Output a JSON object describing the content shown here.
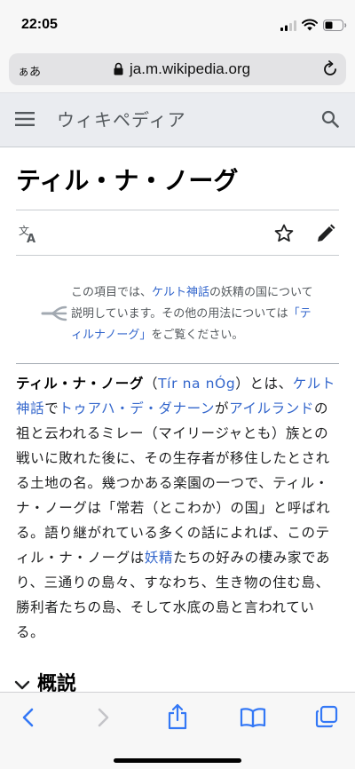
{
  "status": {
    "time": "22:05"
  },
  "address_bar": {
    "text_size_label": "ぁあ",
    "url": "ja.m.wikipedia.org"
  },
  "header": {
    "logo": "ウィキペディア"
  },
  "page": {
    "title": "ティル・ナ・ノーグ"
  },
  "hatnote": {
    "t1": "この項目では、",
    "link1": "ケルト神話",
    "t2": "の妖精の国について説明しています。その他の用法については",
    "link2": "「ティルナノーグ」",
    "t3": "をご覧ください。"
  },
  "article": {
    "bold": "ティル・ナ・ノーグ",
    "p1": "（",
    "link_irish": "Tír na nÓg",
    "p2": "）とは、",
    "link_celtic": "ケルト神話",
    "p3": "で",
    "link_tuatha": "トゥアハ・デ・ダナーン",
    "p4": "が",
    "link_ireland": "アイルランド",
    "p5": "の祖と云われるミレー（マイリージャとも）族との戦いに敗れた後に、その生存者が移住したとされる土地の名。幾つかある楽園の一つで、ティル・ナ・ノーグは「常若（とこわか）の国」と呼ばれる。語り継がれている多くの話によれば、このティル・ナ・ノーグは",
    "link_fairy": "妖精",
    "p6": "たちの好みの棲み家であり、三通りの島々、すなわち、生き物の住む島、勝利者たちの島、そして水底の島と言われている。"
  },
  "section": {
    "heading": "概説"
  },
  "icons": {
    "menu": "hamburger-menu-icon",
    "search": "search-icon",
    "language": "translate-icon",
    "watch": "star-icon",
    "edit": "pencil-icon",
    "disambiguation": "disambiguation-icon",
    "back": "chevron-left-icon",
    "forward": "chevron-right-icon",
    "share": "share-icon",
    "bookmarks": "book-icon",
    "tabs": "tabs-icon"
  },
  "colors": {
    "link": "#3366cc",
    "header_bg": "#eaecf0",
    "text": "#202122"
  }
}
